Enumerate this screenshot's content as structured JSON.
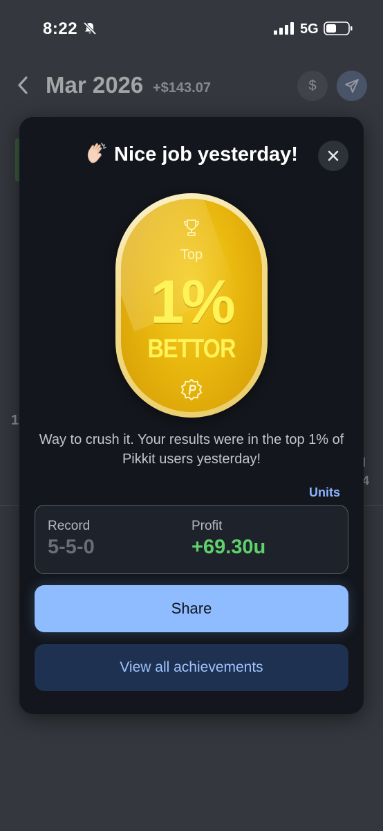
{
  "status_bar": {
    "time": "8:22",
    "network": "5G"
  },
  "header": {
    "month": "Mar 2026",
    "month_profit": "+$143.07",
    "dollar_symbol": "$"
  },
  "background": {
    "fragment_left": "1",
    "fragment_right_top": "l",
    "fragment_right_bottom": "4"
  },
  "modal": {
    "title": "Nice job yesterday!",
    "badge": {
      "top_label": "Top",
      "percent": "1%",
      "label": "BETTOR"
    },
    "message": "Way to crush it. Your results were in the top 1% of Pikkit users yesterday!",
    "units_toggle": "Units",
    "stats": {
      "record_label": "Record",
      "record_value": "5-5-0",
      "profit_label": "Profit",
      "profit_value": "+69.30u"
    },
    "share_label": "Share",
    "achievements_label": "View all achievements"
  },
  "colors": {
    "accent": "#8fbcff",
    "profit_green": "#5fd26e",
    "badge_gold": "#e9b80e",
    "badge_text": "#fff35a",
    "modal_bg": "#13161c"
  }
}
